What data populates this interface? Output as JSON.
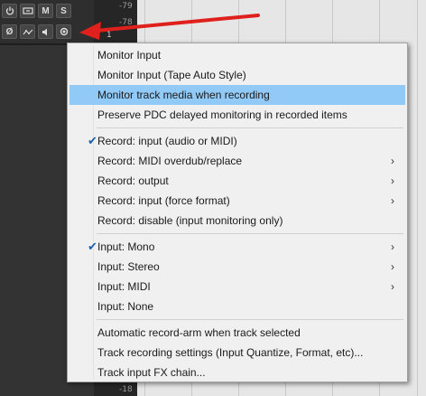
{
  "colors": {
    "menu_bg": "#f0f0f0",
    "highlight": "#91c9f7",
    "check": "#1b5fb0",
    "annotation_arrow": "#e0201c"
  },
  "tcp": {
    "row1": [
      {
        "name": "power-icon",
        "label": ""
      },
      {
        "name": "fx-icon",
        "label": ""
      },
      {
        "name": "mute-button",
        "label": "M"
      },
      {
        "name": "solo-button",
        "label": "S"
      }
    ],
    "row2": [
      {
        "name": "phase-icon",
        "label": "Ø"
      },
      {
        "name": "envelope-icon",
        "label": ""
      },
      {
        "name": "volume-icon",
        "label": ""
      },
      {
        "name": "record-monitor-icon",
        "label": ""
      }
    ]
  },
  "meter": {
    "top_label": "-79",
    "mid_label": "-78",
    "track_number": "1",
    "bottom_label": "-18"
  },
  "menu": {
    "items": [
      {
        "label": "Monitor Input",
        "checked": false,
        "submenu": false
      },
      {
        "label": "Monitor Input (Tape Auto Style)",
        "checked": false,
        "submenu": false
      },
      {
        "label": "Monitor track media when recording",
        "checked": false,
        "submenu": false,
        "highlight": true
      },
      {
        "label": "Preserve PDC delayed monitoring in recorded items",
        "checked": false,
        "submenu": false
      },
      {
        "label": "Record: input (audio or MIDI)",
        "checked": true,
        "submenu": false
      },
      {
        "label": "Record: MIDI overdub/replace",
        "checked": false,
        "submenu": true
      },
      {
        "label": "Record: output",
        "checked": false,
        "submenu": true
      },
      {
        "label": "Record: input (force format)",
        "checked": false,
        "submenu": true
      },
      {
        "label": "Record: disable (input monitoring only)",
        "checked": false,
        "submenu": false
      },
      {
        "label": "Input: Mono",
        "checked": true,
        "submenu": true
      },
      {
        "label": "Input: Stereo",
        "checked": false,
        "submenu": true
      },
      {
        "label": "Input: MIDI",
        "checked": false,
        "submenu": true
      },
      {
        "label": "Input: None",
        "checked": false,
        "submenu": false
      },
      {
        "label": "Automatic record-arm when track selected",
        "checked": false,
        "submenu": false
      },
      {
        "label": "Track recording settings (Input Quantize, Format, etc)...",
        "checked": false,
        "submenu": false
      },
      {
        "label": "Track input FX chain...",
        "checked": false,
        "submenu": false
      }
    ],
    "check_glyph": "✔",
    "submenu_glyph": "›"
  }
}
